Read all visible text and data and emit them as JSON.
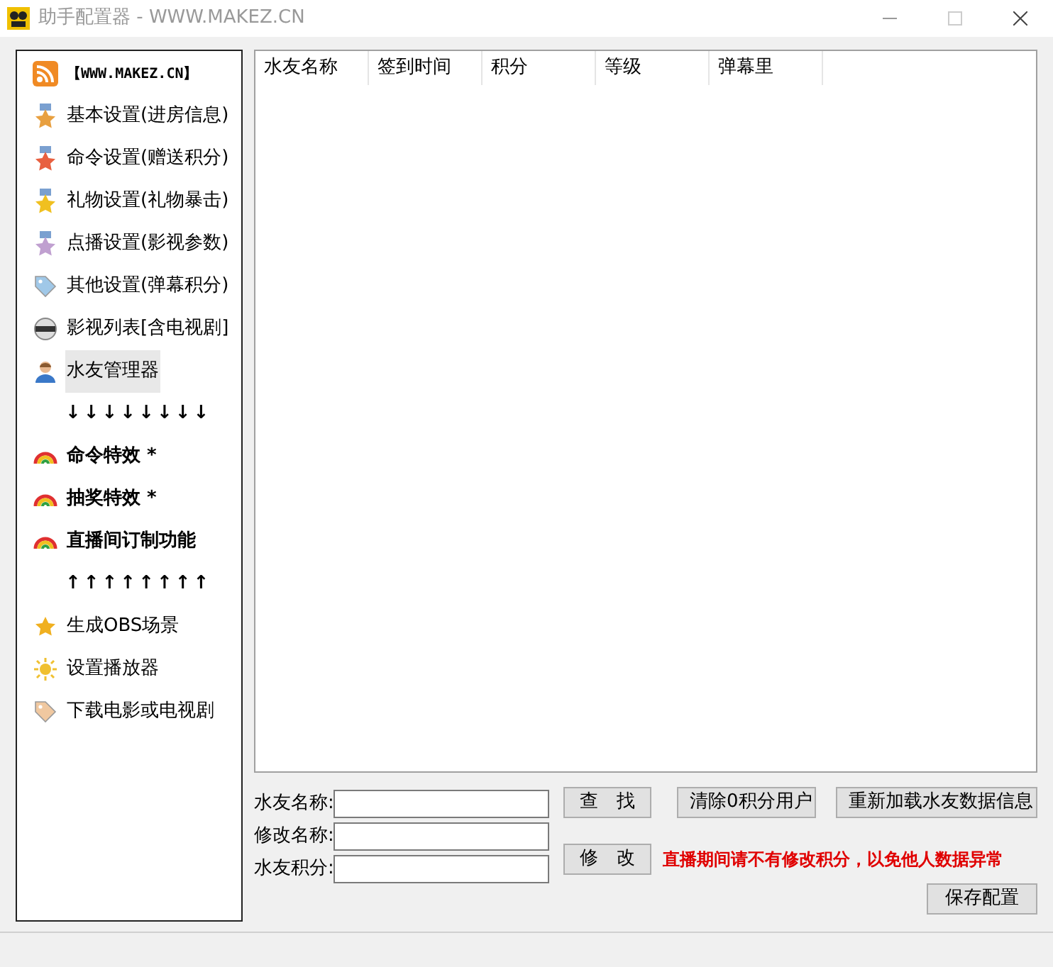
{
  "window": {
    "title": "助手配置器 - WWW.MAKEZ.CN"
  },
  "sidebar": {
    "items": [
      {
        "kind": "link",
        "label": "【WWW.MAKEZ.CN】",
        "selected": false
      },
      {
        "kind": "item",
        "label": "基本设置(进房信息)",
        "selected": false
      },
      {
        "kind": "item",
        "label": "命令设置(赠送积分)",
        "selected": false
      },
      {
        "kind": "item",
        "label": "礼物设置(礼物暴击)",
        "selected": false
      },
      {
        "kind": "item",
        "label": "点播设置(影视参数)",
        "selected": false
      },
      {
        "kind": "item",
        "label": "其他设置(弹幕积分)",
        "selected": false
      },
      {
        "kind": "item",
        "label": "影视列表[含电视剧]",
        "selected": false
      },
      {
        "kind": "item",
        "label": "水友管理器",
        "selected": true
      },
      {
        "kind": "arrows",
        "label": "↓↓↓↓↓↓↓↓"
      },
      {
        "kind": "bold",
        "label": "命令特效 *",
        "selected": false
      },
      {
        "kind": "bold",
        "label": "抽奖特效 *",
        "selected": false
      },
      {
        "kind": "bold",
        "label": "直播间订制功能",
        "selected": false
      },
      {
        "kind": "arrows",
        "label": "↑↑↑↑↑↑↑↑"
      },
      {
        "kind": "item",
        "label": "生成OBS场景",
        "selected": false
      },
      {
        "kind": "item",
        "label": "设置播放器",
        "selected": false
      },
      {
        "kind": "item",
        "label": "下载电影或电视剧",
        "selected": false
      }
    ]
  },
  "table": {
    "columns": [
      "水友名称",
      "签到时间",
      "积分",
      "等级",
      "弹幕里"
    ]
  },
  "form": {
    "fields": [
      {
        "label": "水友名称:"
      },
      {
        "label": "修改名称:"
      },
      {
        "label": "水友积分:"
      }
    ],
    "search_button": "查　找",
    "modify_button": "修　改",
    "clear_button": "清除0积分用户",
    "reload_button": "重新加载水友数据信息",
    "warning": "直播期间请不有修改积分，以免他人数据异常",
    "save_button": "保存配置"
  }
}
